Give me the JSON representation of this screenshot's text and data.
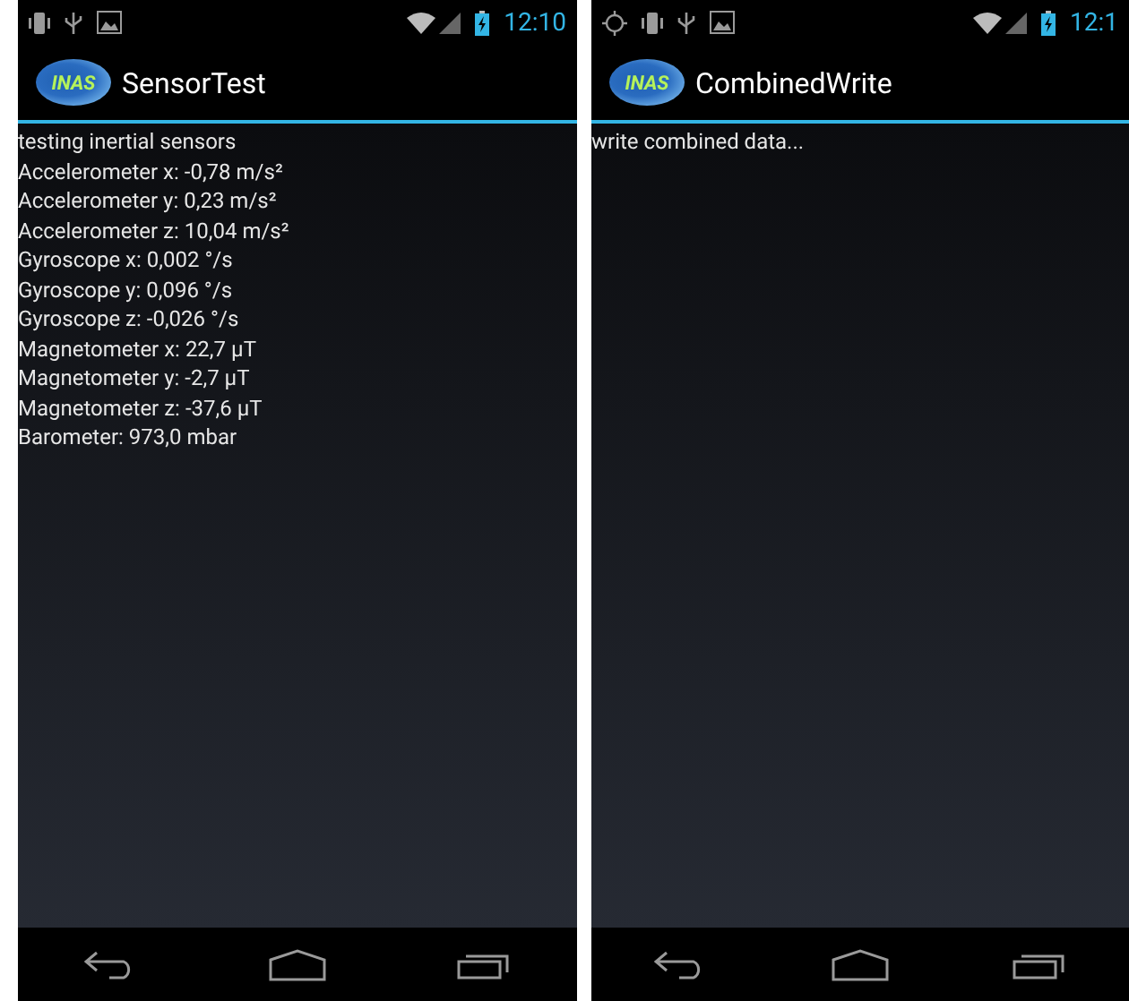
{
  "screens": [
    {
      "status_bar": {
        "notifications": [
          {
            "kind": "vibrate"
          },
          {
            "kind": "usb"
          },
          {
            "kind": "image"
          }
        ],
        "time": "12:10"
      },
      "action_bar": {
        "logo_text": "INAS",
        "title": "SensorTest"
      },
      "lines": [
        "testing inertial sensors",
        "Accelerometer x: -0,78 m/s²",
        "Accelerometer y: 0,23 m/s²",
        "Accelerometer z: 10,04 m/s²",
        "Gyroscope x: 0,002 °/s",
        "Gyroscope y: 0,096 °/s",
        "Gyroscope z: -0,026 °/s",
        "Magnetometer x: 22,7 µT",
        "Magnetometer y: -2,7 µT",
        "Magnetometer z: -37,6 µT",
        "Barometer: 973,0 mbar"
      ]
    },
    {
      "status_bar": {
        "notifications": [
          {
            "kind": "gps"
          },
          {
            "kind": "vibrate"
          },
          {
            "kind": "usb"
          },
          {
            "kind": "image"
          }
        ],
        "time": "12:1"
      },
      "action_bar": {
        "logo_text": "INAS",
        "title": "CombinedWrite"
      },
      "lines": [
        "write combined data..."
      ]
    }
  ]
}
